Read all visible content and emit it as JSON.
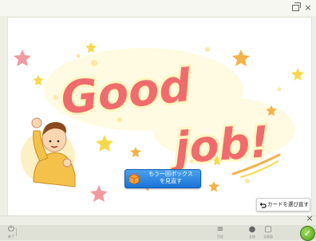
{
  "window": {
    "restore_label": "restore",
    "close_glyph": "×"
  },
  "card": {
    "headline_line1": "Good",
    "headline_line2": "job!",
    "colors": {
      "headline": "#f06b6b",
      "headline_glow": "#fff6c2",
      "star_yellow": "#f6d94a",
      "star_pink": "#f29aa0",
      "star_orange": "#f3b34a"
    }
  },
  "retry_button": {
    "label_line1": "もう一回ボックス",
    "label_line2": "を見直す",
    "icon": "box-icon"
  },
  "back_button": {
    "label": "カードを選び直す",
    "icon": "undo-arrow-icon"
  },
  "bottom": {
    "close_glyph": "×",
    "tray_left_glyph": "⏻",
    "tray_left_caption": "終了",
    "tray_items": [
      {
        "glyph": "≡",
        "caption": "目次"
      },
      {
        "glyph": "●",
        "caption": "全体"
      },
      {
        "glyph": "▢",
        "caption": "全画面"
      }
    ],
    "ok_glyph": "✓"
  }
}
